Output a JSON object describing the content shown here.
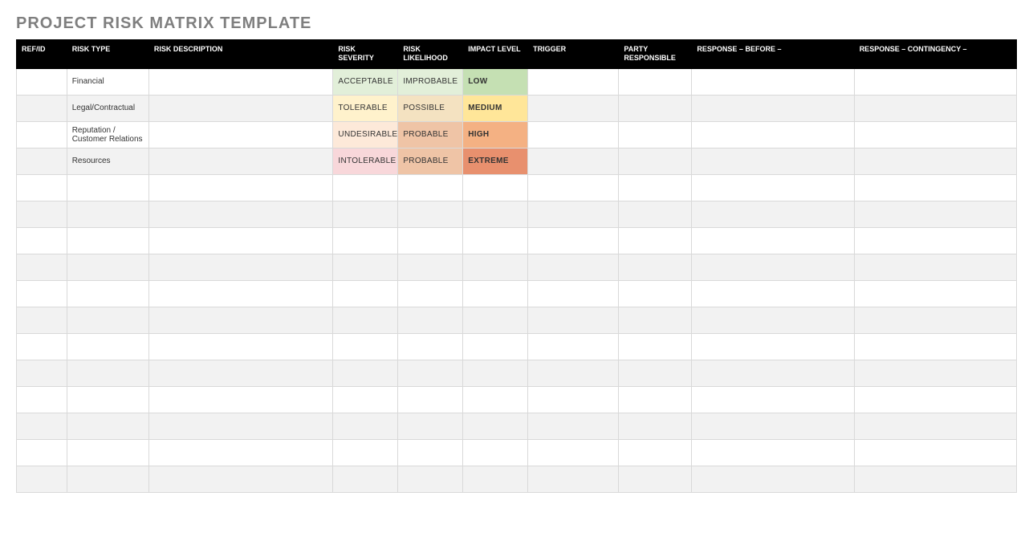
{
  "title": "PROJECT RISK MATRIX TEMPLATE",
  "columns": {
    "refid": "REF/ID",
    "type": "RISK TYPE",
    "desc": "RISK DESCRIPTION",
    "sev": "RISK SEVERITY",
    "like": "RISK LIKELIHOOD",
    "impact": "IMPACT LEVEL",
    "trigger": "TRIGGER",
    "party": "PARTY RESPONSIBLE",
    "before": "RESPONSE – BEFORE –",
    "cont": "RESPONSE – CONTINGENCY –"
  },
  "rows": [
    {
      "refid": "",
      "type": "Financial",
      "desc": "",
      "sev": "ACCEPTABLE",
      "sev_level": 1,
      "like": "IMPROBABLE",
      "like_level": 1,
      "impact": "LOW",
      "impact_level": 1,
      "trigger": "",
      "party": "",
      "before": "",
      "cont": ""
    },
    {
      "refid": "",
      "type": "Legal/Contractual",
      "desc": "",
      "sev": "TOLERABLE",
      "sev_level": 2,
      "like": "POSSIBLE",
      "like_level": 2,
      "impact": "MEDIUM",
      "impact_level": 2,
      "trigger": "",
      "party": "",
      "before": "",
      "cont": ""
    },
    {
      "refid": "",
      "type": "Reputation / Customer Relations",
      "desc": "",
      "sev": "UNDESIRABLE",
      "sev_level": 3,
      "like": "PROBABLE",
      "like_level": 3,
      "impact": "HIGH",
      "impact_level": 3,
      "trigger": "",
      "party": "",
      "before": "",
      "cont": ""
    },
    {
      "refid": "",
      "type": "Resources",
      "desc": "",
      "sev": "INTOLERABLE",
      "sev_level": 4,
      "like": "PROBABLE",
      "like_level": 4,
      "impact": "EXTREME",
      "impact_level": 4,
      "trigger": "",
      "party": "",
      "before": "",
      "cont": ""
    },
    {
      "refid": "",
      "type": "",
      "desc": "",
      "sev": "",
      "sev_level": 0,
      "like": "",
      "like_level": 0,
      "impact": "",
      "impact_level": 0,
      "trigger": "",
      "party": "",
      "before": "",
      "cont": ""
    },
    {
      "refid": "",
      "type": "",
      "desc": "",
      "sev": "",
      "sev_level": 0,
      "like": "",
      "like_level": 0,
      "impact": "",
      "impact_level": 0,
      "trigger": "",
      "party": "",
      "before": "",
      "cont": ""
    },
    {
      "refid": "",
      "type": "",
      "desc": "",
      "sev": "",
      "sev_level": 0,
      "like": "",
      "like_level": 0,
      "impact": "",
      "impact_level": 0,
      "trigger": "",
      "party": "",
      "before": "",
      "cont": ""
    },
    {
      "refid": "",
      "type": "",
      "desc": "",
      "sev": "",
      "sev_level": 0,
      "like": "",
      "like_level": 0,
      "impact": "",
      "impact_level": 0,
      "trigger": "",
      "party": "",
      "before": "",
      "cont": ""
    },
    {
      "refid": "",
      "type": "",
      "desc": "",
      "sev": "",
      "sev_level": 0,
      "like": "",
      "like_level": 0,
      "impact": "",
      "impact_level": 0,
      "trigger": "",
      "party": "",
      "before": "",
      "cont": ""
    },
    {
      "refid": "",
      "type": "",
      "desc": "",
      "sev": "",
      "sev_level": 0,
      "like": "",
      "like_level": 0,
      "impact": "",
      "impact_level": 0,
      "trigger": "",
      "party": "",
      "before": "",
      "cont": ""
    },
    {
      "refid": "",
      "type": "",
      "desc": "",
      "sev": "",
      "sev_level": 0,
      "like": "",
      "like_level": 0,
      "impact": "",
      "impact_level": 0,
      "trigger": "",
      "party": "",
      "before": "",
      "cont": ""
    },
    {
      "refid": "",
      "type": "",
      "desc": "",
      "sev": "",
      "sev_level": 0,
      "like": "",
      "like_level": 0,
      "impact": "",
      "impact_level": 0,
      "trigger": "",
      "party": "",
      "before": "",
      "cont": ""
    },
    {
      "refid": "",
      "type": "",
      "desc": "",
      "sev": "",
      "sev_level": 0,
      "like": "",
      "like_level": 0,
      "impact": "",
      "impact_level": 0,
      "trigger": "",
      "party": "",
      "before": "",
      "cont": ""
    },
    {
      "refid": "",
      "type": "",
      "desc": "",
      "sev": "",
      "sev_level": 0,
      "like": "",
      "like_level": 0,
      "impact": "",
      "impact_level": 0,
      "trigger": "",
      "party": "",
      "before": "",
      "cont": ""
    },
    {
      "refid": "",
      "type": "",
      "desc": "",
      "sev": "",
      "sev_level": 0,
      "like": "",
      "like_level": 0,
      "impact": "",
      "impact_level": 0,
      "trigger": "",
      "party": "",
      "before": "",
      "cont": ""
    },
    {
      "refid": "",
      "type": "",
      "desc": "",
      "sev": "",
      "sev_level": 0,
      "like": "",
      "like_level": 0,
      "impact": "",
      "impact_level": 0,
      "trigger": "",
      "party": "",
      "before": "",
      "cont": ""
    }
  ]
}
